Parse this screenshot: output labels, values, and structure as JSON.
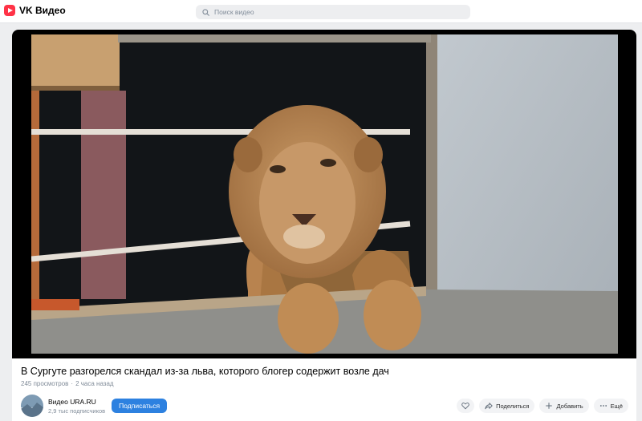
{
  "app": {
    "title": "VK Видео"
  },
  "search": {
    "placeholder": "Поиск видео"
  },
  "video": {
    "title": "В Сургуте разгорелся скандал из-за льва, которого блогер содержит возле дач",
    "views": "245 просмотров",
    "published": "2 часа назад"
  },
  "channel": {
    "name": "Видео URA.RU",
    "subscribers": "2,9 тыс подписчиков",
    "subscribe_label": "Подписаться"
  },
  "actions": {
    "share_label": "Поделиться",
    "add_label": "Добавить",
    "more_label": "Ещё"
  },
  "icons": [
    "search-icon",
    "heart-icon",
    "share-icon",
    "plus-icon",
    "more-icon"
  ],
  "colors": {
    "brand": "#ff3347",
    "accent": "#2d81e0"
  }
}
